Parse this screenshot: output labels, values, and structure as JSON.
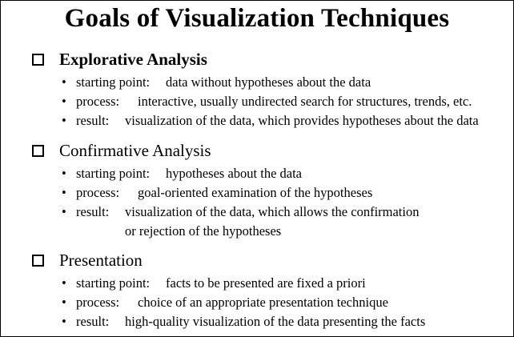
{
  "title": "Goals of Visualization Techniques",
  "bullet": "•",
  "sections": [
    {
      "heading": "Explorative Analysis",
      "items": [
        {
          "label": "starting point:",
          "text": "data without hypotheses about the data"
        },
        {
          "label": "process:",
          "text": "interactive, usually undirected search for structures, trends, etc."
        },
        {
          "label": "result:",
          "text": "visualization of the data, which provides hypotheses about the data"
        }
      ]
    },
    {
      "heading": "Confirmative Analysis",
      "items": [
        {
          "label": "starting point:",
          "text": "hypotheses about the data"
        },
        {
          "label": "process:",
          "text": "goal-oriented examination of the hypotheses"
        },
        {
          "label": "result:",
          "text": "visualization of the data, which allows the confirmation",
          "continuation": "or rejection of the hypotheses"
        }
      ]
    },
    {
      "heading": "Presentation",
      "items": [
        {
          "label": "starting point:",
          "text": "facts to be presented are fixed a priori"
        },
        {
          "label": "process:",
          "text": "choice of an appropriate presentation technique"
        },
        {
          "label": "result:",
          "text": "high-quality visualization of the data presenting the facts"
        }
      ]
    }
  ]
}
